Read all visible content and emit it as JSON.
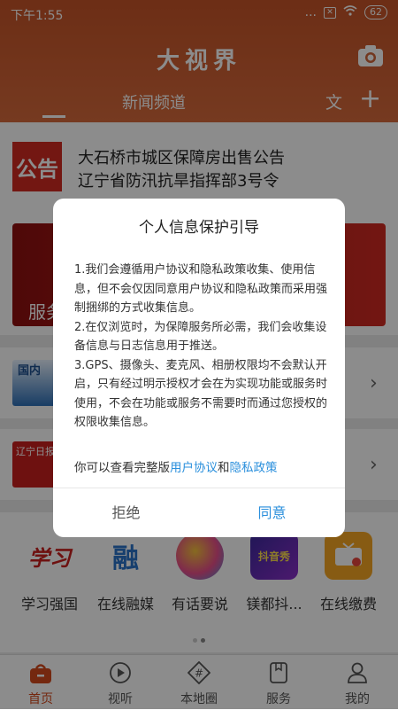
{
  "status_bar": {
    "time": "下午1:55",
    "signal": "...",
    "battery": "62"
  },
  "header": {
    "app_title": "大视界",
    "channel_label": "新闻频道",
    "text_button": "文",
    "add_button": "+"
  },
  "news": {
    "notice_logo": "公告",
    "headlines": [
      "大石桥市城区保障房出售公告",
      "辽宁省防汛抗旱指挥部3号令"
    ],
    "banner_text": "服务"
  },
  "rows": [
    {
      "thumb_text": "国内"
    },
    {
      "thumb_text": "辽宁日报"
    }
  ],
  "apps": [
    {
      "icon_text": "学习",
      "label": "学习强国"
    },
    {
      "icon_text": "融",
      "label": "在线融媒"
    },
    {
      "icon_text": "",
      "label": "有话要说"
    },
    {
      "icon_text": "抖音秀",
      "label": "镁都抖..."
    },
    {
      "icon_text": "",
      "label": "在线缴费"
    }
  ],
  "tabbar": [
    {
      "label": "首页"
    },
    {
      "label": "视听"
    },
    {
      "label": "本地圈"
    },
    {
      "label": "服务"
    },
    {
      "label": "我的"
    }
  ],
  "dialog": {
    "title": "个人信息保护引导",
    "paragraphs": [
      "1.我们会遵循用户协议和隐私政策收集、使用信息，但不会仅因同意用户协议和隐私政策而采用强制捆绑的方式收集信息。",
      "2.在仅浏览时，为保障服务所必需，我们会收集设备信息与日志信息用于推送。",
      "3.GPS、摄像头、麦克风、相册权限均不会默认开启，只有经过明示授权才会在为实现功能或服务时使用，不会在功能或服务不需要时而通过您授权的权限收集信息。"
    ],
    "links_prefix": "你可以查看完整版",
    "user_agreement": "用户协议",
    "and": "和",
    "privacy_policy": "隐私政策",
    "reject": "拒绝",
    "agree": "同意"
  },
  "colors": {
    "brand": "#d76a3c",
    "link": "#2a8fdc",
    "active_tab": "#d34a1d"
  }
}
